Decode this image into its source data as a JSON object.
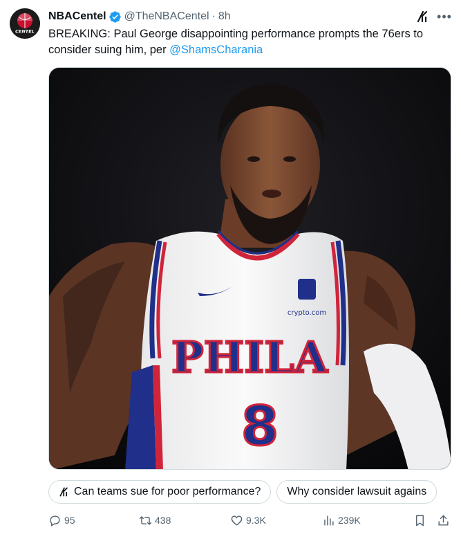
{
  "author": {
    "name": "NBACentel",
    "handle": "@TheNBACentel",
    "separator": "·",
    "time": "8h",
    "avatar_text": "CENTEL"
  },
  "tweet": {
    "text_before": "BREAKING: Paul George disappointing performance prompts the 76ers to consider suing him, per ",
    "mention": "@ShamsCharania"
  },
  "media": {
    "jersey_text": "PHILA",
    "jersey_number": "8",
    "sponsor_text": "crypto.com"
  },
  "suggestions": [
    {
      "label": "Can teams sue for poor performance?",
      "icon": "grok-icon"
    },
    {
      "label": "Why consider lawsuit agains"
    }
  ],
  "actions": {
    "replies": "95",
    "reposts": "438",
    "likes": "9.3K",
    "views": "239K"
  },
  "colors": {
    "accent": "#1d9bf0",
    "muted": "#536471",
    "text": "#0f1419",
    "border": "#cfd9de"
  },
  "icons": [
    "grok-icon",
    "more-icon",
    "verified-badge-icon",
    "reply-icon",
    "repost-icon",
    "like-icon",
    "views-icon",
    "bookmark-icon",
    "share-icon"
  ]
}
